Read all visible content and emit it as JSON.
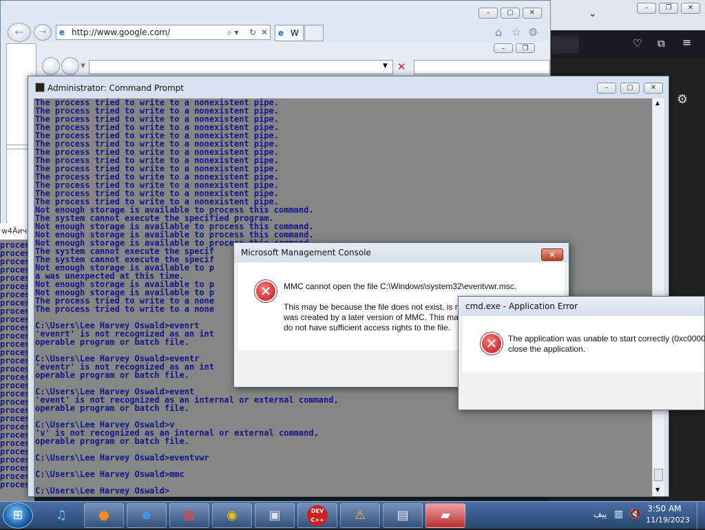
{
  "ie": {
    "address": "http://www.google.com/",
    "tab_label": "W"
  },
  "left_strip": {
    "header": "w4Äич:",
    "lines": [
      "process",
      "process",
      "process",
      "process",
      "process",
      "process",
      "process",
      "process",
      "process",
      "process",
      "process",
      "process",
      "process",
      "process",
      "process",
      "process",
      "process",
      "process",
      "process",
      "process",
      "process",
      "process",
      "process",
      "process",
      "process",
      "process",
      "process",
      "process",
      "process",
      "process"
    ]
  },
  "cmd": {
    "title": "Administrator: Command Prompt",
    "lines": [
      "The process tried to write to a nonexistent pipe.",
      "The process tried to write to a nonexistent pipe.",
      "The process tried to write to a nonexistent pipe.",
      "The process tried to write to a nonexistent pipe.",
      "The process tried to write to a nonexistent pipe.",
      "The process tried to write to a nonexistent pipe.",
      "The process tried to write to a nonexistent pipe.",
      "The process tried to write to a nonexistent pipe.",
      "The process tried to write to a nonexistent pipe.",
      "The process tried to write to a nonexistent pipe.",
      "The process tried to write to a nonexistent pipe.",
      "The process tried to write to a nonexistent pipe.",
      "The process tried to write to a nonexistent pipe.",
      "Not enough storage is available to process this command.",
      "The system cannot execute the specified program.",
      "Not enough storage is available to process this command.",
      "Not enough storage is available to process this command.",
      "Not enough storage is available to process this command.",
      "The system cannot execute the specif",
      "The system cannot execute the specif",
      "Not enough storage is available to p",
      "a was unexpected at this time.",
      "Not enough storage is available to p",
      "Not enough storage is available to p",
      "The process tried to write to a none",
      "The process tried to write to a none",
      "",
      "C:\\Users\\Lee Harvey Oswald>evenrt",
      "'evenrt' is not recognized as an int",
      "operable program or batch file.",
      "",
      "C:\\Users\\Lee Harvey Oswald>eventr",
      "'eventr' is not recognized as an int",
      "operable program or batch file.",
      "",
      "C:\\Users\\Lee Harvey Oswald>event",
      "'event' is not recognized as an internal or external command,",
      "operable program or batch file.",
      "",
      "C:\\Users\\Lee Harvey Oswald>v",
      "'v' is not recognized as an internal or external command,",
      "operable program or batch file.",
      "",
      "C:\\Users\\Lee Harvey Oswald>eventvwr",
      "",
      "C:\\Users\\Lee Harvey Oswald>mmc",
      "",
      "C:\\Users\\Lee Harvey Oswald>"
    ]
  },
  "mmc": {
    "title": "Microsoft Management Console",
    "line1": "MMC cannot open the file C:\\Windows\\system32\\eventvwr.msc.",
    "line2": "This may be because the file does not exist, is nc",
    "line3": "was created by a later version of MMC. This may",
    "line4": "do not have sufficient access rights to the file."
  },
  "apperror": {
    "title": "cmd.exe - Application Error",
    "line1": "The application was unable to start correctly (0xc00001",
    "line2": "close the application."
  },
  "tray": {
    "lang": "پیف",
    "time": "3:50 AM",
    "date": "11/19/2023"
  },
  "taskbar": {
    "devcpp_label": "DEV C++"
  },
  "colors": {
    "console_bg": "#868686",
    "console_text": "#14148a"
  }
}
